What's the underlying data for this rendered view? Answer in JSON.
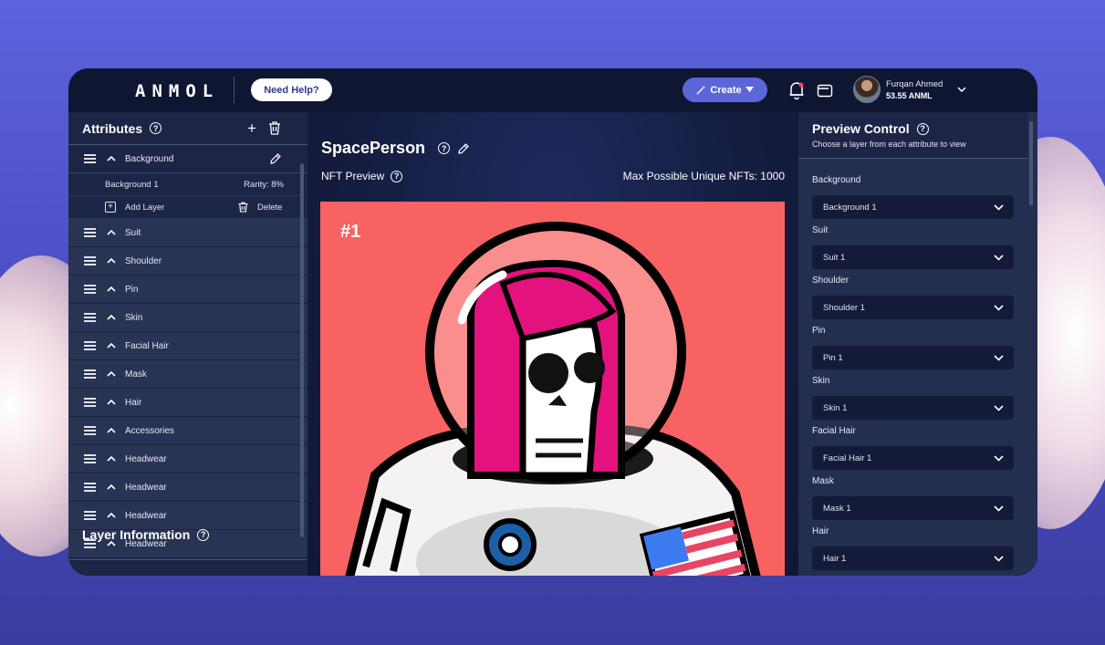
{
  "app": {
    "logo": "ANMOL",
    "help_button": "Need Help?",
    "create_button": "Create",
    "user": {
      "name": "Furqan Ahmed",
      "balance": "53.55 ANML"
    }
  },
  "left": {
    "title": "Attributes",
    "open_item": "Background",
    "open_sub": {
      "layer": "Background 1",
      "rarity": "Rarity: 8%",
      "add_label": "Add Layer",
      "delete_label": "Delete"
    },
    "items": [
      "Suit",
      "Shoulder",
      "Pin",
      "Skin",
      "Facial Hair",
      "Mask",
      "Hair",
      "Accessories",
      "Headwear",
      "Headwear",
      "Headwear",
      "Headwear"
    ],
    "layer_info_title": "Layer Information"
  },
  "center": {
    "title": "SpacePerson",
    "preview_label": "NFT Preview",
    "max_label": "Max Possible Unique NFTs: 1000",
    "art_number": "#1"
  },
  "right": {
    "title": "Preview Control",
    "subtitle": "Choose a layer from each attribute to view",
    "controls": [
      {
        "label": "Background",
        "value": "Background 1"
      },
      {
        "label": "Suit",
        "value": "Suit 1"
      },
      {
        "label": "Shoulder",
        "value": "Shoulder 1"
      },
      {
        "label": "Pin",
        "value": "Pin 1"
      },
      {
        "label": "Skin",
        "value": "Skin 1"
      },
      {
        "label": "Facial Hair",
        "value": "Facial Hair 1"
      },
      {
        "label": "Mask",
        "value": "Mask 1"
      },
      {
        "label": "Hair",
        "value": "Hair 1"
      }
    ]
  },
  "colors": {
    "accent": "#5b66d9",
    "art_bg": "#f86262",
    "hair": "#e3127f",
    "panel": "#242e4f"
  }
}
